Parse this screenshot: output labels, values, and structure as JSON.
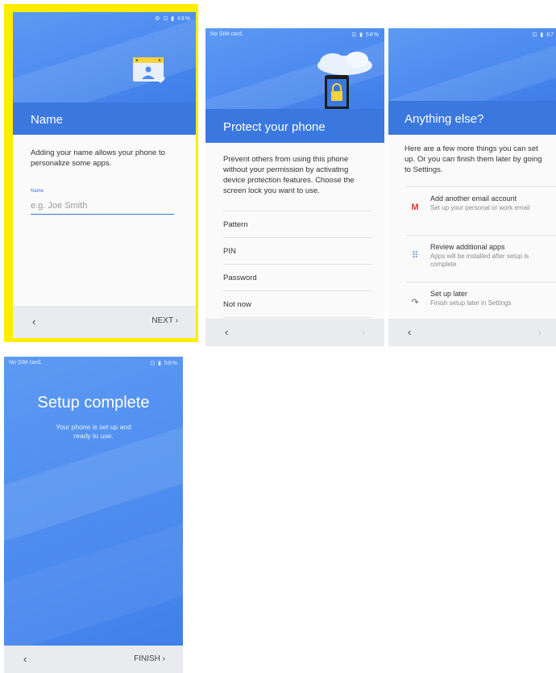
{
  "colors": {
    "highlight": "#ffed00",
    "accent": "#3a78e0",
    "hero": "#4c8bf0",
    "navbar": "#e9ebee"
  },
  "screen_name": {
    "status_icons": "⚙ ⊡ ▮ 48%",
    "title": "Name",
    "description": "Adding your name allows your phone to personalize some apps.",
    "field_label": "Name",
    "field_placeholder": "e.g. Joe Smith",
    "back_icon": "‹",
    "next_label": "NEXT ›"
  },
  "screen_protect": {
    "carrier": "No SIM card.",
    "status_icons": "⊡ ▮ 58%",
    "title": "Protect your phone",
    "description": "Prevent others from using this phone without your permission by activating device protection features. Choose the screen lock you want to use.",
    "options": [
      "Pattern",
      "PIN",
      "Password",
      "Not now"
    ],
    "back_icon": "‹",
    "next_icon": "›"
  },
  "screen_else": {
    "status_icons": "⊡ ▮ 87",
    "title": "Anything else?",
    "description": "Here are a few more things you can set up. Or you can finish them later by going to Settings.",
    "items": [
      {
        "icon": "gmail-icon",
        "title": "Add another email account",
        "subtitle": "Set up your personal or work email"
      },
      {
        "icon": "apps-grid-icon",
        "title": "Review additional apps",
        "subtitle": "Apps will be installed after setup is complete"
      },
      {
        "icon": "later-icon",
        "title": "Set up later",
        "subtitle": "Finish setup later in Settings"
      }
    ],
    "back_icon": "‹",
    "next_icon": "›"
  },
  "screen_complete": {
    "carrier": "No SIM card.",
    "status_icons": "⊡ ▮ 58%",
    "title": "Setup complete",
    "subtitle": "Your phone is set up and ready to use.",
    "back_icon": "‹",
    "finish_label": "FINISH ›"
  }
}
